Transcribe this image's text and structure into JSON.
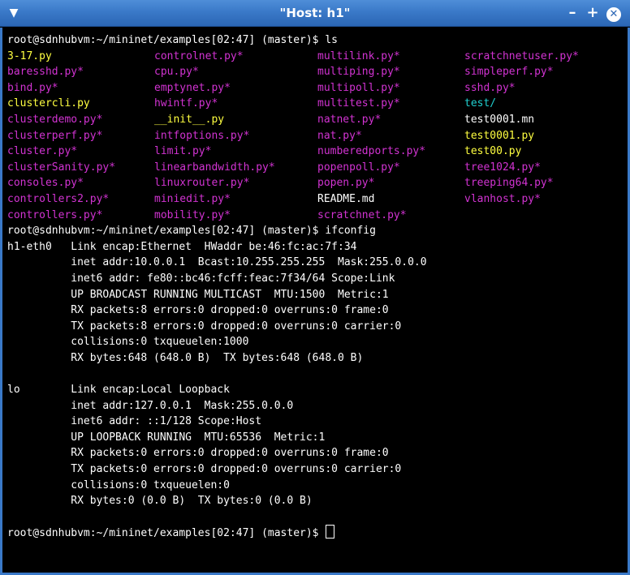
{
  "window": {
    "title": "\"Host: h1\"",
    "menu_glyph": "▼",
    "min_glyph": "–",
    "max_glyph": "+",
    "close_glyph": "✕"
  },
  "colors": {
    "titlebar": "#3a79c8",
    "exec": "#d233d2",
    "py": "#ffff40",
    "dir": "#20d0d0",
    "text": "#ffffff",
    "bg": "#000000"
  },
  "prompt": "root@sdnhubvm:~/mininet/examples[02:47] (master)$ ",
  "commands": [
    "ls",
    "ifconfig",
    ""
  ],
  "ls_rows": [
    [
      {
        "t": "3-17.py",
        "k": "py"
      },
      {
        "t": "controlnet.py*",
        "k": "exec"
      },
      {
        "t": "multilink.py*",
        "k": "exec"
      },
      {
        "t": "scratchnetuser.py*",
        "k": "exec"
      }
    ],
    [
      {
        "t": "baresshd.py*",
        "k": "exec"
      },
      {
        "t": "cpu.py*",
        "k": "exec"
      },
      {
        "t": "multiping.py*",
        "k": "exec"
      },
      {
        "t": "simpleperf.py*",
        "k": "exec"
      }
    ],
    [
      {
        "t": "bind.py*",
        "k": "exec"
      },
      {
        "t": "emptynet.py*",
        "k": "exec"
      },
      {
        "t": "multipoll.py*",
        "k": "exec"
      },
      {
        "t": "sshd.py*",
        "k": "exec"
      }
    ],
    [
      {
        "t": "clustercli.py",
        "k": "py"
      },
      {
        "t": "hwintf.py*",
        "k": "exec"
      },
      {
        "t": "multitest.py*",
        "k": "exec"
      },
      {
        "t": "test/",
        "k": "dir"
      }
    ],
    [
      {
        "t": "clusterdemo.py*",
        "k": "exec"
      },
      {
        "t": "__init__.py",
        "k": "py"
      },
      {
        "t": "natnet.py*",
        "k": "exec"
      },
      {
        "t": "test0001.mn",
        "k": "plain"
      }
    ],
    [
      {
        "t": "clusterperf.py*",
        "k": "exec"
      },
      {
        "t": "intfoptions.py*",
        "k": "exec"
      },
      {
        "t": "nat.py*",
        "k": "exec"
      },
      {
        "t": "test0001.py",
        "k": "py"
      }
    ],
    [
      {
        "t": "cluster.py*",
        "k": "exec"
      },
      {
        "t": "limit.py*",
        "k": "exec"
      },
      {
        "t": "numberedports.py*",
        "k": "exec"
      },
      {
        "t": "test00.py",
        "k": "py"
      }
    ],
    [
      {
        "t": "clusterSanity.py*",
        "k": "exec"
      },
      {
        "t": "linearbandwidth.py*",
        "k": "exec"
      },
      {
        "t": "popenpoll.py*",
        "k": "exec"
      },
      {
        "t": "tree1024.py*",
        "k": "exec"
      }
    ],
    [
      {
        "t": "consoles.py*",
        "k": "exec"
      },
      {
        "t": "linuxrouter.py*",
        "k": "exec"
      },
      {
        "t": "popen.py*",
        "k": "exec"
      },
      {
        "t": "treeping64.py*",
        "k": "exec"
      }
    ],
    [
      {
        "t": "controllers2.py*",
        "k": "exec"
      },
      {
        "t": "miniedit.py*",
        "k": "exec"
      },
      {
        "t": "README.md",
        "k": "plain"
      },
      {
        "t": "vlanhost.py*",
        "k": "exec"
      }
    ],
    [
      {
        "t": "controllers.py*",
        "k": "exec"
      },
      {
        "t": "mobility.py*",
        "k": "exec"
      },
      {
        "t": "scratchnet.py*",
        "k": "exec"
      },
      {
        "t": "",
        "k": "plain"
      }
    ]
  ],
  "ifconfig_lines": [
    "h1-eth0   Link encap:Ethernet  HWaddr be:46:fc:ac:7f:34",
    "          inet addr:10.0.0.1  Bcast:10.255.255.255  Mask:255.0.0.0",
    "          inet6 addr: fe80::bc46:fcff:feac:7f34/64 Scope:Link",
    "          UP BROADCAST RUNNING MULTICAST  MTU:1500  Metric:1",
    "          RX packets:8 errors:0 dropped:0 overruns:0 frame:0",
    "          TX packets:8 errors:0 dropped:0 overruns:0 carrier:0",
    "          collisions:0 txqueuelen:1000",
    "          RX bytes:648 (648.0 B)  TX bytes:648 (648.0 B)",
    "",
    "lo        Link encap:Local Loopback",
    "          inet addr:127.0.0.1  Mask:255.0.0.0",
    "          inet6 addr: ::1/128 Scope:Host",
    "          UP LOOPBACK RUNNING  MTU:65536  Metric:1",
    "          RX packets:0 errors:0 dropped:0 overruns:0 frame:0",
    "          TX packets:0 errors:0 dropped:0 overruns:0 carrier:0",
    "          collisions:0 txqueuelen:0",
    "          RX bytes:0 (0.0 B)  TX bytes:0 (0.0 B)",
    ""
  ]
}
